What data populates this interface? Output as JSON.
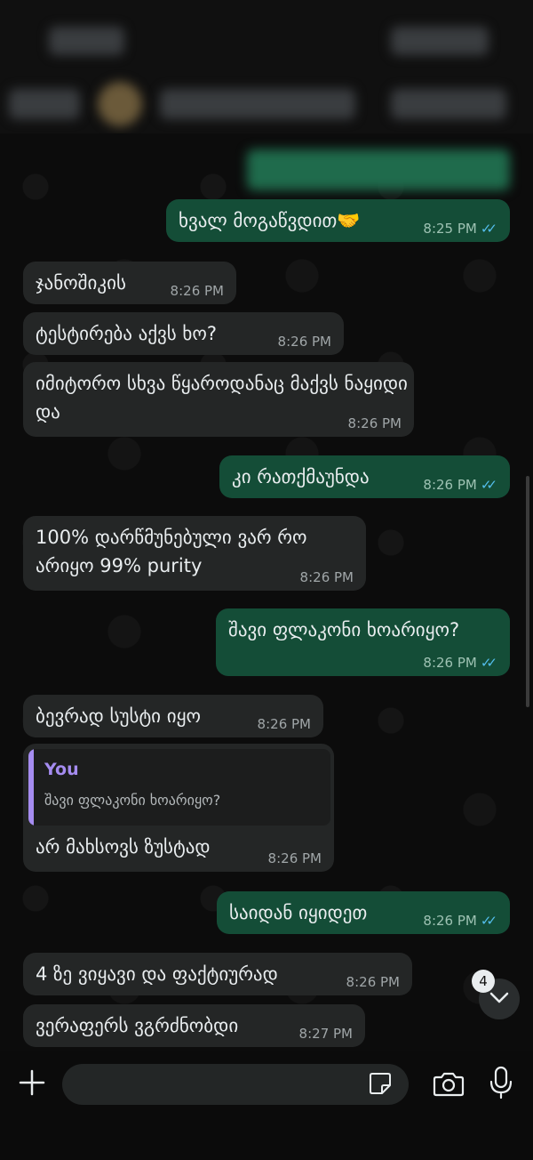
{
  "messages": [
    {
      "text": "ხვალ მოგაწვდით🤝",
      "time": "8:25 PM",
      "dir": "out",
      "read": true
    },
    {
      "text": "ჯანოშიკის",
      "time": "8:26 PM",
      "dir": "in"
    },
    {
      "text": "ტესტირება აქვს ხო?",
      "time": "8:26 PM",
      "dir": "in"
    },
    {
      "text": "იმიტორო სხვა წყაროდანაც მაქვს ნაყიდი და",
      "time": "8:26 PM",
      "dir": "in"
    },
    {
      "text": "კი რათქმაუნდა",
      "time": "8:26 PM",
      "dir": "out",
      "read": true
    },
    {
      "text": "100% დარწმუნებული ვარ რო არიყო 99% purity",
      "time": "8:26 PM",
      "dir": "in"
    },
    {
      "text": "შავი ფლაკონი ხოარიყო?",
      "time": "8:26 PM",
      "dir": "out",
      "read": true
    },
    {
      "text": "ბევრად სუსტი იყო",
      "time": "8:26 PM",
      "dir": "in"
    },
    {
      "text": "არ მახსოვს ზუსტად",
      "time": "8:26 PM",
      "dir": "in",
      "reply": {
        "author": "You",
        "text": "შავი ფლაკონი ხოარიყო?"
      }
    },
    {
      "text": "საიდან იყიდეთ",
      "time": "8:26 PM",
      "dir": "out",
      "read": true
    },
    {
      "text": "4 ზე ვიყავი და ფაქტიურად",
      "time": "8:26 PM",
      "dir": "in"
    },
    {
      "text": "ვერაფერს ვგრძნობდი",
      "time": "8:27 PM",
      "dir": "in"
    }
  ],
  "unread_count": "4",
  "colors": {
    "outgoing": "#144d37",
    "incoming": "#242626",
    "read_tick": "#53bdeb",
    "reply_accent": "#a58cf0"
  },
  "icons": [
    "plus-icon",
    "sticker-icon",
    "camera-icon",
    "microphone-icon",
    "chevron-down-icon"
  ]
}
